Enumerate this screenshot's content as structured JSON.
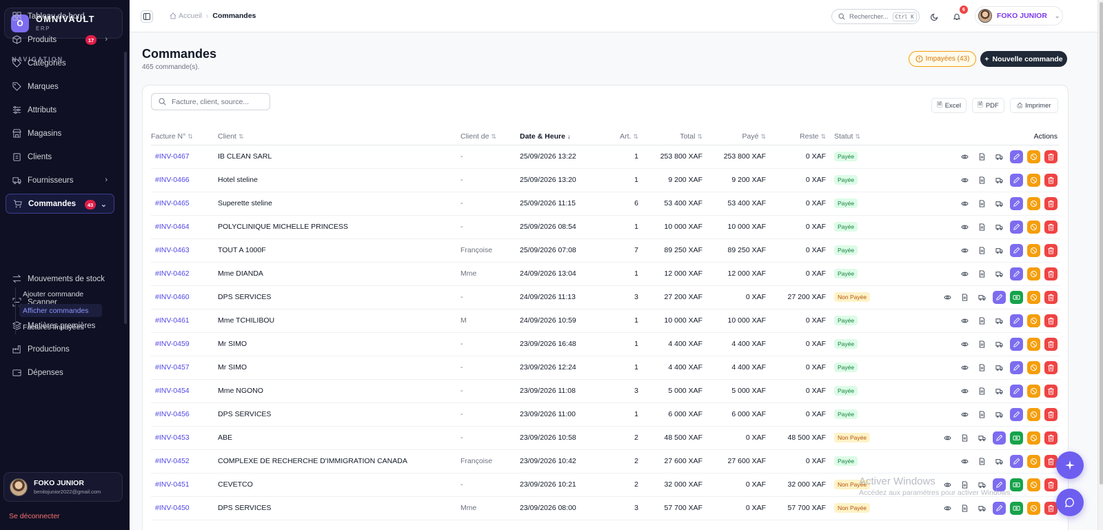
{
  "brand": {
    "logo_letter": "O",
    "name": "OMNIVAULT",
    "sub": "ERP"
  },
  "nav": {
    "title": "NAVIGATION",
    "items": [
      {
        "label": "Tableau de bord",
        "icon": "dashboard-icon"
      },
      {
        "label": "Produits",
        "icon": "box-icon",
        "badge": "17",
        "arrow": "›"
      },
      {
        "label": "Catégories",
        "icon": "tag-icon"
      },
      {
        "label": "Marques",
        "icon": "tag-icon"
      },
      {
        "label": "Attributs",
        "icon": "sliders-icon"
      },
      {
        "label": "Magasins",
        "icon": "store-icon"
      },
      {
        "label": "Clients",
        "icon": "clipboard-icon"
      },
      {
        "label": "Fournisseurs",
        "icon": "truck-icon",
        "arrow": "›"
      },
      {
        "label": "Commandes",
        "icon": "cart-icon",
        "badge": "43",
        "arrow": "⌄"
      },
      {
        "label": "Mouvements de stock",
        "icon": "arrows-icon"
      },
      {
        "label": "Scanner",
        "icon": "scan-icon"
      },
      {
        "label": "Matières premières",
        "icon": "layers-icon"
      },
      {
        "label": "Productions",
        "icon": "factory-icon"
      },
      {
        "label": "Dépenses",
        "icon": "wallet-icon"
      }
    ],
    "sub_items": [
      "Ajouter commande",
      "Afficher commandes",
      "Factures impayées"
    ]
  },
  "user": {
    "name": "FOKO JUNIOR",
    "email": "benitojunior2022@gmail.com",
    "logout": "Se déconnecter"
  },
  "topbar": {
    "crumb_home": "Accueil",
    "crumb_sep": "›",
    "crumb_current": "Commandes",
    "search_label": "Rechercher...",
    "search_kbd": "Ctrl K",
    "notif_count": "6",
    "profile_name": "FOKO JUNIOR",
    "profile_chev": "⌄"
  },
  "page": {
    "title": "Commandes",
    "subtitle": "465 commande(s).",
    "unpaid_button": "Impayées (43)",
    "new_button": "Nouvelle commande"
  },
  "toolbar": {
    "search_placeholder": "Facture, client, source...",
    "excel": "Excel",
    "pdf": "PDF",
    "print": "Imprimer"
  },
  "table": {
    "headers": [
      "Facture N°",
      "Client",
      "Client de",
      "Date & Heure",
      "Art.",
      "Total",
      "Payé",
      "Reste",
      "Statut",
      "Actions"
    ],
    "rows": [
      {
        "inv": "#INV-0467",
        "client": "IB CLEAN SARL",
        "source": "-",
        "date": "25/09/2026 13:22",
        "qty": "1",
        "total": "253 800 XAF",
        "paid": "253 800 XAF",
        "rest": "0 XAF",
        "status": "Payée",
        "state": "paid"
      },
      {
        "inv": "#INV-0466",
        "client": "Hotel steline",
        "source": "-",
        "date": "25/09/2026 13:20",
        "qty": "1",
        "total": "9 200 XAF",
        "paid": "9 200 XAF",
        "rest": "0 XAF",
        "status": "Payée",
        "state": "paid"
      },
      {
        "inv": "#INV-0465",
        "client": "Superette steline",
        "source": "-",
        "date": "25/09/2026 11:15",
        "qty": "6",
        "total": "53 400 XAF",
        "paid": "53 400 XAF",
        "rest": "0 XAF",
        "status": "Payée",
        "state": "paid"
      },
      {
        "inv": "#INV-0464",
        "client": "POLYCLINIQUE MICHELLE PRINCESS",
        "source": "-",
        "date": "25/09/2026 08:54",
        "qty": "1",
        "total": "10 000 XAF",
        "paid": "10 000 XAF",
        "rest": "0 XAF",
        "status": "Payée",
        "state": "paid"
      },
      {
        "inv": "#INV-0463",
        "client": "TOUT A 1000F",
        "source": "Françoise",
        "date": "25/09/2026 07:08",
        "qty": "7",
        "total": "89 250 XAF",
        "paid": "89 250 XAF",
        "rest": "0 XAF",
        "status": "Payée",
        "state": "paid"
      },
      {
        "inv": "#INV-0462",
        "client": "Mme DIANDA",
        "source": "Mme",
        "date": "24/09/2026 13:04",
        "qty": "1",
        "total": "12 000 XAF",
        "paid": "12 000 XAF",
        "rest": "0 XAF",
        "status": "Payée",
        "state": "paid"
      },
      {
        "inv": "#INV-0460",
        "client": "DPS SERVICES",
        "source": "-",
        "date": "24/09/2026 11:13",
        "qty": "3",
        "total": "27 200 XAF",
        "paid": "0 XAF",
        "rest": "27 200 XAF",
        "status": "Non Payée",
        "state": "unpaid"
      },
      {
        "inv": "#INV-0461",
        "client": "Mme TCHILIBOU",
        "source": "M",
        "date": "24/09/2026 10:59",
        "qty": "1",
        "total": "10 000 XAF",
        "paid": "10 000 XAF",
        "rest": "0 XAF",
        "status": "Payée",
        "state": "paid"
      },
      {
        "inv": "#INV-0459",
        "client": "Mr SIMO",
        "source": "-",
        "date": "23/09/2026 16:48",
        "qty": "1",
        "total": "4 400 XAF",
        "paid": "4 400 XAF",
        "rest": "0 XAF",
        "status": "Payée",
        "state": "paid"
      },
      {
        "inv": "#INV-0457",
        "client": "Mr SIMO",
        "source": "-",
        "date": "23/09/2026 12:24",
        "qty": "1",
        "total": "4 400 XAF",
        "paid": "4 400 XAF",
        "rest": "0 XAF",
        "status": "Payée",
        "state": "paid"
      },
      {
        "inv": "#INV-0454",
        "client": "Mme NGONO",
        "source": "-",
        "date": "23/09/2026 11:08",
        "qty": "3",
        "total": "5 000 XAF",
        "paid": "5 000 XAF",
        "rest": "0 XAF",
        "status": "Payée",
        "state": "paid"
      },
      {
        "inv": "#INV-0456",
        "client": "DPS SERVICES",
        "source": "-",
        "date": "23/09/2026 11:00",
        "qty": "1",
        "total": "6 000 XAF",
        "paid": "6 000 XAF",
        "rest": "0 XAF",
        "status": "Payée",
        "state": "paid"
      },
      {
        "inv": "#INV-0453",
        "client": "ABE",
        "source": "-",
        "date": "23/09/2026 10:58",
        "qty": "2",
        "total": "48 500 XAF",
        "paid": "0 XAF",
        "rest": "48 500 XAF",
        "status": "Non Payée",
        "state": "unpaid"
      },
      {
        "inv": "#INV-0452",
        "client": "COMPLEXE DE RECHERCHE D'IMMIGRATION CANADA",
        "source": "Françoise",
        "date": "23/09/2026 10:42",
        "qty": "2",
        "total": "27 600 XAF",
        "paid": "27 600 XAF",
        "rest": "0 XAF",
        "status": "Payée",
        "state": "paid"
      },
      {
        "inv": "#INV-0451",
        "client": "CEVETCO",
        "source": "-",
        "date": "23/09/2026 10:21",
        "qty": "2",
        "total": "32 000 XAF",
        "paid": "0 XAF",
        "rest": "32 000 XAF",
        "status": "Non Payée",
        "state": "unpaid"
      },
      {
        "inv": "#INV-0450",
        "client": "DPS SERVICES",
        "source": "Mme",
        "date": "23/09/2026 08:00",
        "qty": "3",
        "total": "57 700 XAF",
        "paid": "0 XAF",
        "rest": "57 700 XAF",
        "status": "Non Payée",
        "state": "unpaid"
      }
    ]
  },
  "watermark": {
    "line1": "Activer Windows",
    "line2": "Accédez aux paramètres pour activer Windows."
  },
  "colors": {
    "accent": "#7c6cf0",
    "sidebar_bg": "#0f1023",
    "paid": "#15803d",
    "unpaid": "#b45309",
    "danger": "#ef4444",
    "warning": "#f59e0b"
  }
}
